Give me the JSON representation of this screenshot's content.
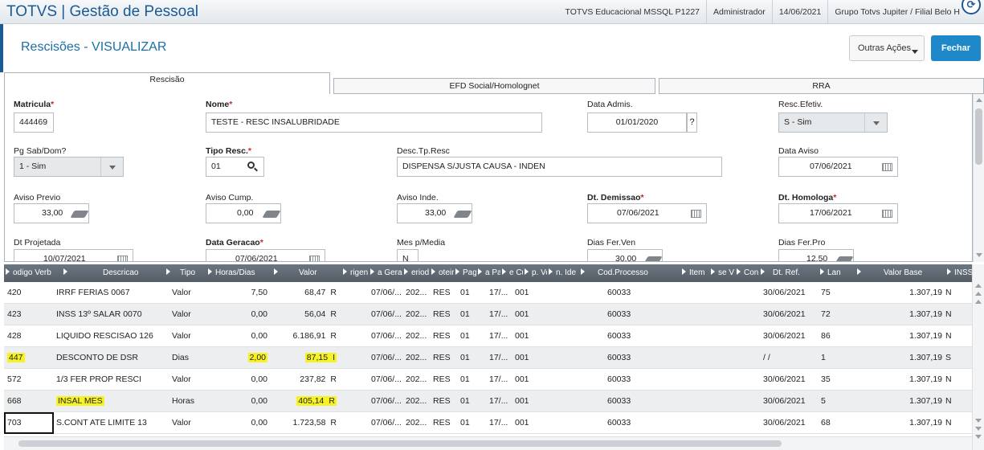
{
  "topbar": {
    "app_title": "TOTVS | Gestão de Pessoal",
    "database": "TOTVS Educacional MSSQL P1227",
    "user": "Administrador",
    "date": "14/06/2021",
    "company": "Grupo Totvs Jupiter / Filial Belo H",
    "help_icon": "help-icon"
  },
  "header": {
    "title": "Rescisões - VISUALIZAR",
    "other_actions_label": "Outras Ações",
    "close_label": "Fechar"
  },
  "tabs": [
    {
      "label": "Rescisão",
      "active": true
    },
    {
      "label": "EFD Social/Homolognet",
      "active": false
    },
    {
      "label": "RRA",
      "active": false
    }
  ],
  "form": {
    "matricula": {
      "label": "Matricula",
      "value": "444469",
      "required": true
    },
    "nome": {
      "label": "Nome",
      "value": "TESTE - RESC INSALUBRIDADE",
      "required": true
    },
    "data_admis": {
      "label": "Data Admis.",
      "value": "01/01/2020",
      "help": "?"
    },
    "resc_efetiv": {
      "label": "Resc.Efetiv.",
      "value": "S - Sim"
    },
    "pg_sab_dom": {
      "label": "Pg Sab/Dom?",
      "value": "1 - Sim"
    },
    "tipo_resc": {
      "label": "Tipo Resc.",
      "value": "01",
      "required": true
    },
    "desc_tp_resc": {
      "label": "Desc.Tp.Resc",
      "value": "DISPENSA S/JUSTA CAUSA - INDEN"
    },
    "data_aviso": {
      "label": "Data Aviso",
      "value": "07/06/2021"
    },
    "aviso_previo": {
      "label": "Aviso Previo",
      "value": "33,00"
    },
    "aviso_cump": {
      "label": "Aviso Cump.",
      "value": "0,00"
    },
    "aviso_inde": {
      "label": "Aviso Inde.",
      "value": "33,00"
    },
    "dt_demissao": {
      "label": "Dt. Demissao",
      "value": "07/06/2021",
      "required": true
    },
    "dt_homologa": {
      "label": "Dt. Homologa",
      "value": "17/06/2021",
      "required": true
    },
    "dt_projetada": {
      "label": "Dt Projetada",
      "value": "10/07/2021"
    },
    "data_geracao": {
      "label": "Data Geracao",
      "value": "07/06/2021",
      "required": true
    },
    "mes_media": {
      "label": "Mes p/Media",
      "value": "N"
    },
    "dias_fer_ven": {
      "label": "Dias Fer.Ven",
      "value": "30,00"
    },
    "dias_fer_pro": {
      "label": "Dias Fer.Pro",
      "value": "12,50"
    }
  },
  "grid": {
    "columns": [
      "odigo Verb",
      "Descricao",
      "Tipo",
      "Horas/Dias",
      "Valor",
      "rigen",
      "a Gerac",
      "eriod",
      "oteir",
      "Pag",
      "a Pa",
      "e Cu",
      "p. Ve",
      "n. Ide",
      "Cod.Processo",
      "Item",
      "se V",
      "Con",
      "Dt. Ref.",
      "Lan",
      "Valor Base",
      "INSS"
    ],
    "rows": [
      {
        "codigo": "420",
        "descricao": "IRRF FERIAS 0067",
        "tipo": "Valor",
        "horas": "7,50",
        "valor": "68,47",
        "origem": "R",
        "geracao": "07/06/...",
        "periodo": "202...",
        "roteiro": "RES",
        "pag": "01",
        "data_pag": "17/...",
        "ccusto": "001",
        "cod_processo": "60033",
        "dt_ref": "30/06/2021",
        "lanc": "75",
        "valor_base": "1.307,19",
        "inss": "N"
      },
      {
        "codigo": "423",
        "descricao": "INSS 13º SALAR 0070",
        "tipo": "Valor",
        "horas": "0,00",
        "valor": "56,04",
        "origem": "R",
        "geracao": "07/06/...",
        "periodo": "202...",
        "roteiro": "RES",
        "pag": "01",
        "data_pag": "17/...",
        "ccusto": "001",
        "cod_processo": "60033",
        "dt_ref": "30/06/2021",
        "lanc": "72",
        "valor_base": "1.307,19",
        "inss": "N"
      },
      {
        "codigo": "428",
        "descricao": "LIQUIDO RESCISAO 126",
        "tipo": "Valor",
        "horas": "0,00",
        "valor": "6.186,91",
        "origem": "R",
        "geracao": "07/06/...",
        "periodo": "202...",
        "roteiro": "RES",
        "pag": "01",
        "data_pag": "17/...",
        "ccusto": "001",
        "cod_processo": "60033",
        "dt_ref": "30/06/2021",
        "lanc": "86",
        "valor_base": "1.307,19",
        "inss": "N"
      },
      {
        "codigo": "447",
        "descricao": "DESCONTO DE DSR",
        "tipo": "Dias",
        "horas": "2,00",
        "valor": "87,15",
        "origem": "I",
        "geracao": "07/06/...",
        "periodo": "202...",
        "roteiro": "RES",
        "pag": "01",
        "data_pag": "17/...",
        "ccusto": "001",
        "cod_processo": "60033",
        "dt_ref": "/ /",
        "lanc": "1",
        "valor_base": "1.307,19",
        "inss": "S"
      },
      {
        "codigo": "572",
        "descricao": "1/3 FER PROP RESCI",
        "tipo": "Valor",
        "horas": "0,00",
        "valor": "237,82",
        "origem": "R",
        "geracao": "07/06/...",
        "periodo": "202...",
        "roteiro": "RES",
        "pag": "01",
        "data_pag": "17/...",
        "ccusto": "001",
        "cod_processo": "60033",
        "dt_ref": "30/06/2021",
        "lanc": "35",
        "valor_base": "1.307,19",
        "inss": "N"
      },
      {
        "codigo": "668",
        "descricao": "INSAL MES",
        "tipo": "Horas",
        "horas": "0,00",
        "valor": "405,14",
        "origem": "R",
        "geracao": "07/06/...",
        "periodo": "202...",
        "roteiro": "RES",
        "pag": "01",
        "data_pag": "17/...",
        "ccusto": "001",
        "cod_processo": "60033",
        "dt_ref": "30/06/2021",
        "lanc": "5",
        "valor_base": "1.307,19",
        "inss": "N"
      },
      {
        "codigo": "703",
        "descricao": "S.CONT ATE LIMITE 13",
        "tipo": "Valor",
        "horas": "0,00",
        "valor": "1.723,58",
        "origem": "R",
        "geracao": "07/06/...",
        "periodo": "202...",
        "roteiro": "RES",
        "pag": "01",
        "data_pag": "17/...",
        "ccusto": "001",
        "cod_processo": "60033",
        "dt_ref": "30/06/2021",
        "lanc": "68",
        "valor_base": "1.307,19",
        "inss": "N"
      }
    ]
  },
  "colors": {
    "brand": "#1a5a95",
    "accent": "#1e88c9",
    "highlight": "#f6f224",
    "required": "#d32020"
  }
}
